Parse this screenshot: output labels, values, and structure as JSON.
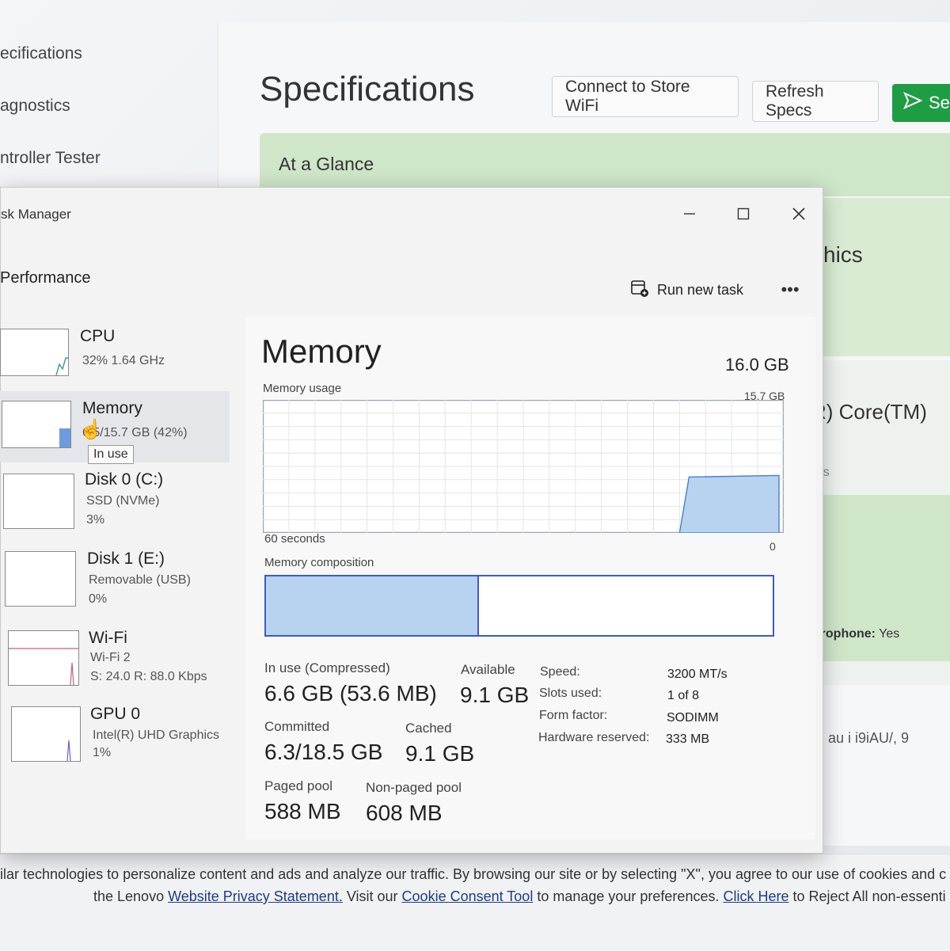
{
  "background": {
    "nav_items": [
      "ecifications",
      "agnostics",
      "ntroller Tester"
    ],
    "heading": "Specifications",
    "buttons": {
      "wifi": "Connect to Store WiFi",
      "refresh": "Refresh Specs",
      "send": "Se"
    },
    "at_a_glance": "At a Glance",
    "graphics_clipped": "hics",
    "core_clipped": "R) Core(TM)",
    "ads_clipped": "ads",
    "microphone_label": "Microphone:",
    "microphone_value": "Yes",
    "clipped_text": "ucai au i i9iAU/, 9",
    "cookie": {
      "line1": "ilar technologies to personalize content and ads and analyze our traffic. By browsing our site or by selecting \"X\", you agree to our use of cookies and c",
      "line2_prefix": "the Lenovo ",
      "privacy_link": "Website Privacy Statement.",
      "line2_mid": " Visit our ",
      "consent_link": "Cookie Consent Tool",
      "line2_mid2": " to manage your preferences. ",
      "click_here": "Click Here",
      "line2_suffix": " to Reject All non-essenti"
    }
  },
  "task_manager": {
    "title": "sk Manager",
    "section": "Performance",
    "run_new_task": "Run new task",
    "more": "•••",
    "sidebar": [
      {
        "title": "CPU",
        "sub1": "32%  1.64 GHz",
        "sub2": "",
        "sub3": ""
      },
      {
        "title": "Memory",
        "sub1": "6.5/15.7 GB (42%)",
        "sub2": "",
        "sub3": ""
      },
      {
        "title": "Disk 0 (C:)",
        "sub1": "SSD (NVMe)",
        "sub2": "3%",
        "sub3": ""
      },
      {
        "title": "Disk 1 (E:)",
        "sub1": "Removable (USB)",
        "sub2": "0%",
        "sub3": ""
      },
      {
        "title": "Wi-Fi",
        "sub1": "Wi-Fi 2",
        "sub2": "S: 24.0  R: 88.0 Kbps",
        "sub3": ""
      },
      {
        "title": "GPU 0",
        "sub1": "Intel(R) UHD Graphics",
        "sub2": "1%",
        "sub3": ""
      }
    ],
    "tooltip": "In use",
    "memory": {
      "title": "Memory",
      "total": "16.0 GB",
      "usage_label": "Memory usage",
      "usage_max": "15.7 GB",
      "graph_left": "60 seconds",
      "graph_right": "0",
      "composition_label": "Memory composition",
      "composition_in_use_fraction": 0.42,
      "usage_level_fraction": 0.42,
      "stats": {
        "in_use_label": "In use (Compressed)",
        "in_use_value": "6.6 GB (53.6 MB)",
        "available_label": "Available",
        "available_value": "9.1 GB",
        "committed_label": "Committed",
        "committed_value": "6.3/18.5 GB",
        "cached_label": "Cached",
        "cached_value": "9.1 GB",
        "paged_label": "Paged pool",
        "paged_value": "588 MB",
        "nonpaged_label": "Non-paged pool",
        "nonpaged_value": "608 MB"
      },
      "specs": {
        "speed_label": "Speed:",
        "speed_value": "3200 MT/s",
        "slots_label": "Slots used:",
        "slots_value": "1 of 8",
        "form_label": "Form factor:",
        "form_value": "SODIMM",
        "reserved_label": "Hardware reserved:",
        "reserved_value": "333 MB"
      }
    }
  },
  "colors": {
    "accent": "#3c5bc8",
    "fill": "#b8d3f0",
    "send_green": "#1f9d44"
  },
  "icons": [
    "run-task-icon",
    "minimize-icon",
    "maximize-icon",
    "close-icon",
    "send-icon",
    "hand-cursor-icon"
  ]
}
